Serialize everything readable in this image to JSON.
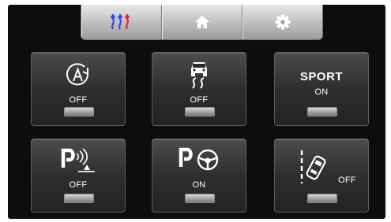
{
  "topbar": {
    "tabs": [
      {
        "icon": "heated-seat-icon"
      },
      {
        "icon": "home-icon"
      },
      {
        "icon": "gear-icon"
      }
    ],
    "colors": {
      "blue": "#3a43e6",
      "red": "#e0262c",
      "white": "#ffffff"
    }
  },
  "tiles": [
    {
      "icon": "auto-hold-icon",
      "status": "OFF"
    },
    {
      "icon": "skid-control-icon",
      "status": "OFF"
    },
    {
      "label": "SPORT",
      "status": "ON"
    },
    {
      "icon": "parking-sensor-icon",
      "status": "OFF"
    },
    {
      "icon": "parking-steering-assist-icon",
      "status": "ON"
    },
    {
      "icon": "lane-assist-icon",
      "status": "OFF"
    }
  ]
}
